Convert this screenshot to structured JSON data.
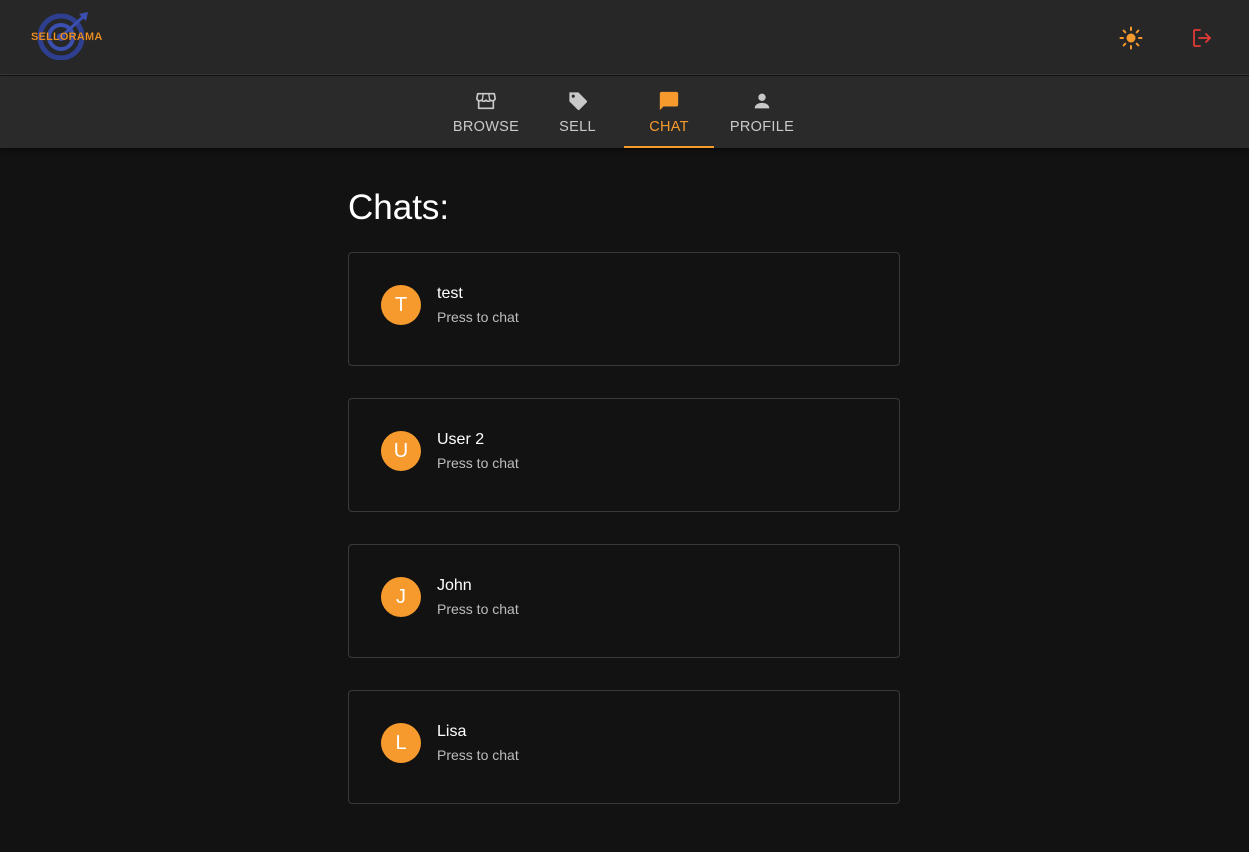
{
  "app": {
    "logo_text": "SELLORAMA",
    "accent_color": "#f79a2e",
    "logout_color": "#e53935"
  },
  "header": {
    "theme_toggle_icon": "sun-icon",
    "logout_icon": "logout-icon"
  },
  "tabs": [
    {
      "label": "BROWSE",
      "icon": "storefront-icon",
      "active": false
    },
    {
      "label": "SELL",
      "icon": "tag-icon",
      "active": false
    },
    {
      "label": "CHAT",
      "icon": "chat-bubble-icon",
      "active": true
    },
    {
      "label": "PROFILE",
      "icon": "person-icon",
      "active": false
    }
  ],
  "page": {
    "title": "Chats:"
  },
  "chats": [
    {
      "initial": "T",
      "name": "test",
      "subtitle": "Press to chat"
    },
    {
      "initial": "U",
      "name": "User 2",
      "subtitle": "Press to chat"
    },
    {
      "initial": "J",
      "name": "John",
      "subtitle": "Press to chat"
    },
    {
      "initial": "L",
      "name": "Lisa",
      "subtitle": "Press to chat"
    }
  ]
}
